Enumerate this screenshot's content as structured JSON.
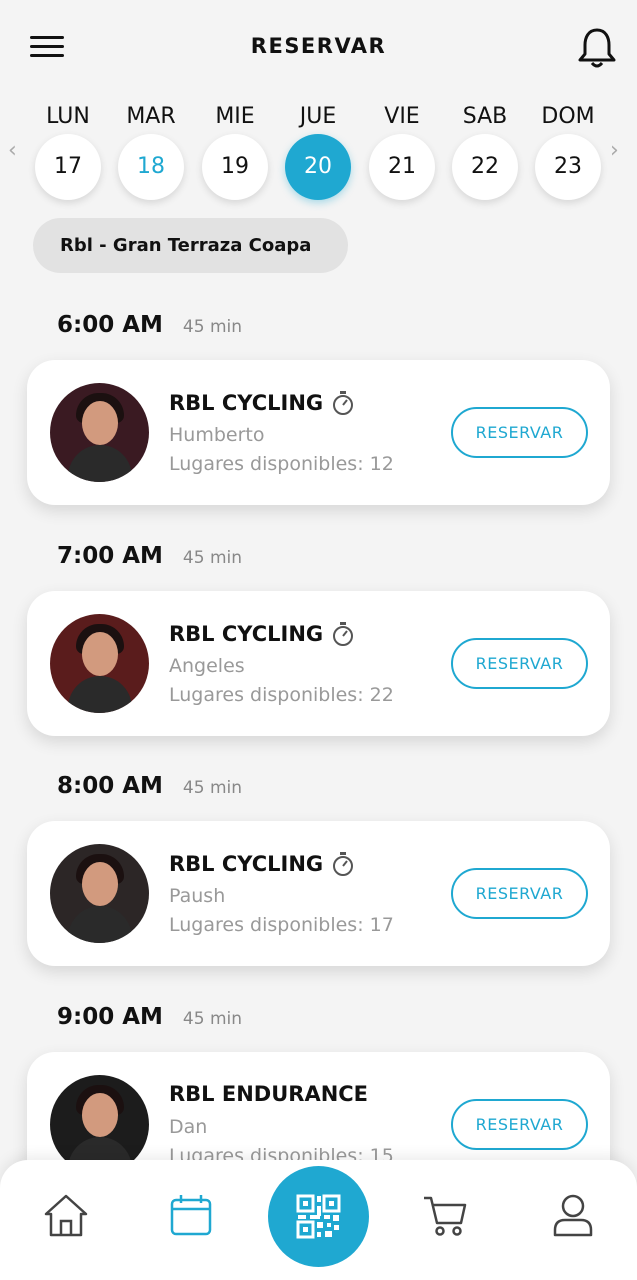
{
  "header": {
    "title": "RESERVAR"
  },
  "days": [
    {
      "name": "LUN",
      "num": "17"
    },
    {
      "name": "MAR",
      "num": "18"
    },
    {
      "name": "MIE",
      "num": "19"
    },
    {
      "name": "JUE",
      "num": "20"
    },
    {
      "name": "VIE",
      "num": "21"
    },
    {
      "name": "SAB",
      "num": "22"
    },
    {
      "name": "DOM",
      "num": "23"
    }
  ],
  "location": "Rbl - Gran Terraza Coapa",
  "classes": [
    {
      "time": "6:00 AM",
      "duration": "45 min",
      "name": "RBL CYCLING",
      "coach": "Humberto",
      "spots": "Lugares disponibles: 12",
      "button": "RESERVAR"
    },
    {
      "time": "7:00 AM",
      "duration": "45 min",
      "name": "RBL CYCLING",
      "coach": "Angeles",
      "spots": "Lugares disponibles: 22",
      "button": "RESERVAR"
    },
    {
      "time": "8:00 AM",
      "duration": "45 min",
      "name": "RBL CYCLING",
      "coach": "Paush",
      "spots": "Lugares disponibles: 17",
      "button": "RESERVAR"
    },
    {
      "time": "9:00 AM",
      "duration": "45 min",
      "name": "RBL ENDURANCE",
      "coach": "Dan",
      "spots": "Lugares disponibles: 15",
      "button": "RESERVAR"
    }
  ],
  "colors": {
    "accent": "#1fa8d1"
  },
  "icons": [
    "menu-icon",
    "bell-icon",
    "chevron-left-icon",
    "chevron-right-icon",
    "timer-icon",
    "home-icon",
    "calendar-icon",
    "qr-code-icon",
    "cart-icon",
    "user-icon"
  ]
}
